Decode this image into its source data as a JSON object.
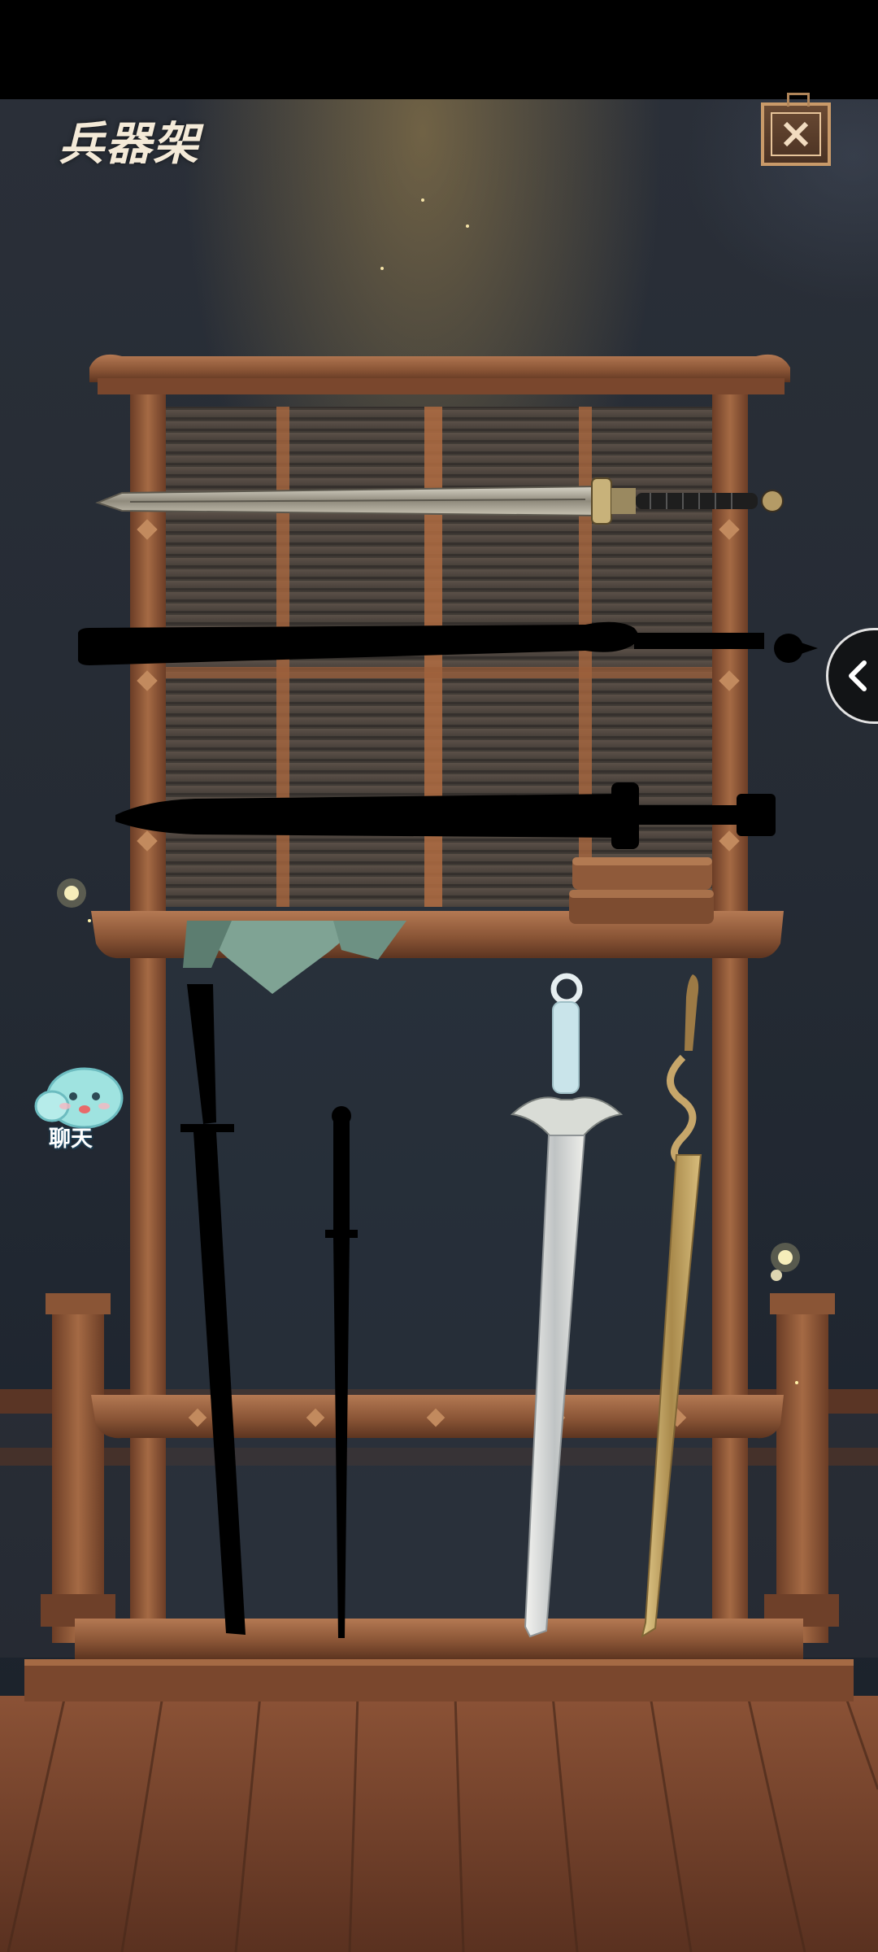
{
  "header": {
    "title": "兵器架"
  },
  "chat": {
    "label": "聊天"
  },
  "rack": {
    "horizontal_slots": [
      {
        "state": "unlocked",
        "type": "sword"
      },
      {
        "state": "locked",
        "type": "silhouette"
      },
      {
        "state": "locked",
        "type": "silhouette"
      }
    ],
    "vertical_slots": [
      {
        "state": "locked",
        "type": "silhouette"
      },
      {
        "state": "locked",
        "type": "silhouette"
      },
      {
        "state": "unlocked",
        "type": "white-jade-sword"
      },
      {
        "state": "unlocked",
        "type": "golden-serpent-sword"
      }
    ]
  },
  "colors": {
    "wood": "#8a5536",
    "wood_light": "#b87a52",
    "night": "#252b34",
    "floor": "#6e3f2a"
  }
}
